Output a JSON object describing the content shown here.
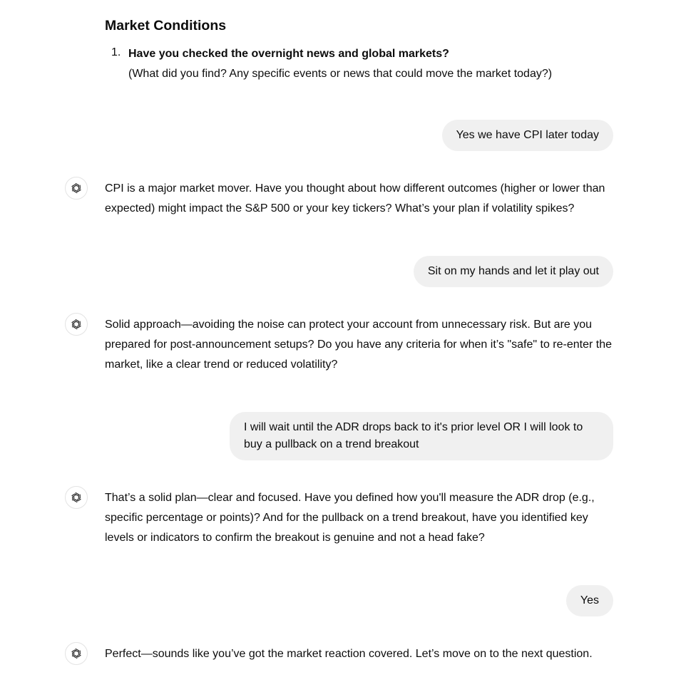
{
  "section": {
    "heading": "Market Conditions",
    "question_number": "1.",
    "question_title": "Have you checked the overnight news and global markets?",
    "question_sub": "(What did you find? Any specific events or news that could move the market today?)"
  },
  "messages": [
    {
      "role": "user",
      "text": "Yes we have CPI later today"
    },
    {
      "role": "assistant",
      "text": "CPI is a major market mover. Have you thought about how different outcomes (higher or lower than expected) might impact the S&P 500 or your key tickers? What’s your plan if volatility spikes?"
    },
    {
      "role": "user",
      "text": "Sit on my hands and let it play out"
    },
    {
      "role": "assistant",
      "text": "Solid approach—avoiding the noise can protect your account from unnecessary risk. But are you prepared for post-announcement setups? Do you have any criteria for when it’s \"safe\" to re-enter the market, like a clear trend or reduced volatility?"
    },
    {
      "role": "user",
      "text": "I will wait until the ADR drops back to it's prior level OR I will look to buy a pullback on a trend breakout"
    },
    {
      "role": "assistant",
      "text": "That’s a solid plan—clear and focused. Have you defined how you'll measure the ADR drop (e.g., specific percentage or points)? And for the pullback on a trend breakout, have you identified key levels or indicators to confirm the breakout is genuine and not a head fake?"
    },
    {
      "role": "user",
      "text": "Yes"
    },
    {
      "role": "assistant",
      "text": "Perfect—sounds like you’ve got the market reaction covered. Let’s move on to the next question."
    }
  ],
  "icons": {
    "assistant_avatar": "openai-logo-icon"
  }
}
